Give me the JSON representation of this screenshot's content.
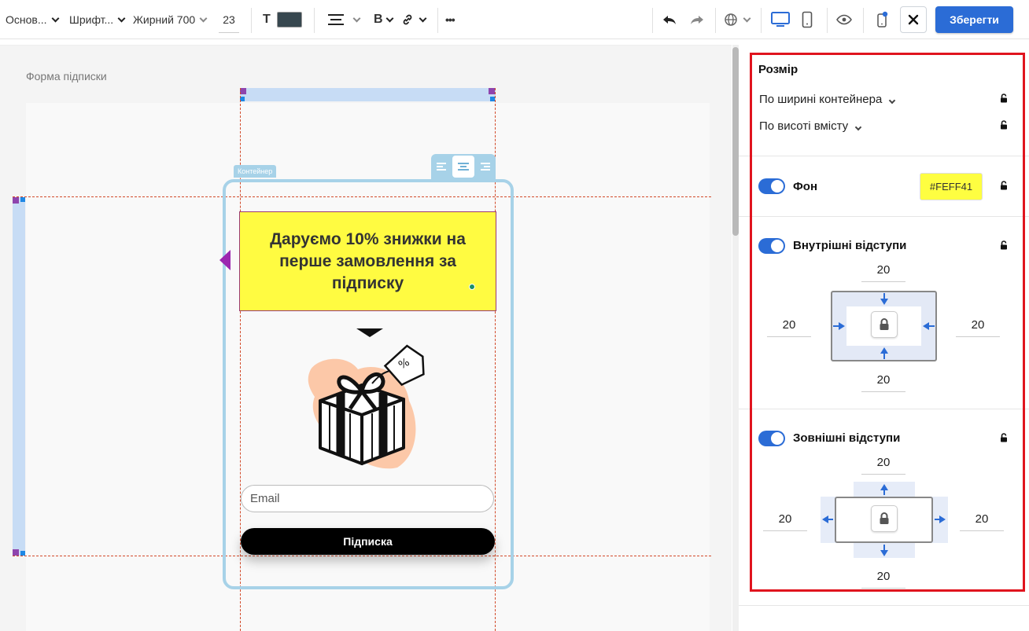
{
  "toolbar": {
    "style_label": "Основ...",
    "font_label": "Шрифт...",
    "weight_label": "Жирний 700",
    "font_size": "23",
    "text_color_icon": "T",
    "bold_icon": "B",
    "more_label": "•••",
    "save_label": "Зберегти"
  },
  "canvas": {
    "section_title": "Форма підписки",
    "container_tag": "Контейнер",
    "headline": "Даруємо 10% знижки на перше замовлення за підписку",
    "email_placeholder": "Email",
    "subscribe_label": "Підписка"
  },
  "panel": {
    "size_title": "Розмір",
    "width_mode": "По ширині контейнера",
    "height_mode": "По висоті вмісту",
    "background_label": "Фон",
    "background_color": "#FEFF41",
    "padding_label": "Внутрішні відступи",
    "padding": {
      "top": "20",
      "right": "20",
      "bottom": "20",
      "left": "20"
    },
    "margin_label": "Зовнішні відступи",
    "margin": {
      "top": "20",
      "right": "20",
      "bottom": "20",
      "left": "20"
    }
  },
  "colors": {
    "accent": "#2b6cd6",
    "highlight": "#e0141e",
    "headline_bg": "#fffb41"
  }
}
